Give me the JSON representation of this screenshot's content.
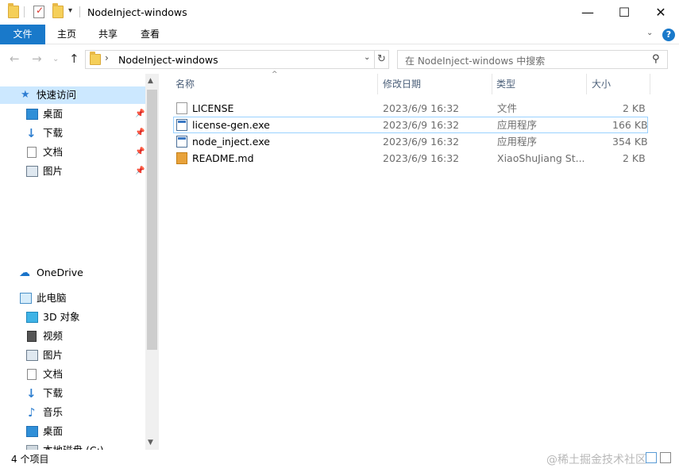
{
  "window": {
    "title": "NodeInject-windows",
    "controls": {
      "minimize": "—",
      "maximize": "☐",
      "close": "✕"
    }
  },
  "ribbon": {
    "tabs": [
      "文件",
      "主页",
      "共享",
      "查看"
    ],
    "help": "?",
    "collapse": "⌄"
  },
  "address": {
    "path": "NodeInject-windows",
    "chevron": "›",
    "dropdown": "⌄",
    "refresh": "↻",
    "search_placeholder": "在 NodeInject-windows 中搜索",
    "nav": {
      "back": "←",
      "forward": "→",
      "recent": "⌄",
      "up": "↑"
    }
  },
  "navpane": {
    "quick_access": "快速访问",
    "quick_items": [
      "桌面",
      "下载",
      "文档",
      "图片"
    ],
    "onedrive": "OneDrive",
    "this_pc": "此电脑",
    "pc_items": [
      "3D 对象",
      "视频",
      "图片",
      "文档",
      "下载",
      "音乐",
      "桌面",
      "本地磁盘 (C:)"
    ],
    "pin_glyph": "📌"
  },
  "filelist": {
    "columns": [
      "名称",
      "修改日期",
      "类型",
      "大小"
    ],
    "sort_indicator": "^",
    "rows": [
      {
        "name": "LICENSE",
        "date": "2023/6/9 16:32",
        "type": "文件",
        "size": "2 KB",
        "icon": "file-icon"
      },
      {
        "name": "license-gen.exe",
        "date": "2023/6/9 16:32",
        "type": "应用程序",
        "size": "166 KB",
        "icon": "exe-icon"
      },
      {
        "name": "node_inject.exe",
        "date": "2023/6/9 16:32",
        "type": "应用程序",
        "size": "354 KB",
        "icon": "exe-icon"
      },
      {
        "name": "README.md",
        "date": "2023/6/9 16:32",
        "type": "XiaoShuJiang St...",
        "size": "2 KB",
        "icon": "markdown-icon"
      }
    ]
  },
  "status": {
    "item_count": "4 个项目",
    "watermark": "@稀土掘金技术社区"
  },
  "colors": {
    "accent": "#1979ca",
    "selection": "#cce8ff",
    "hover_border": "#99d1ff",
    "header_text": "#4c607a"
  }
}
